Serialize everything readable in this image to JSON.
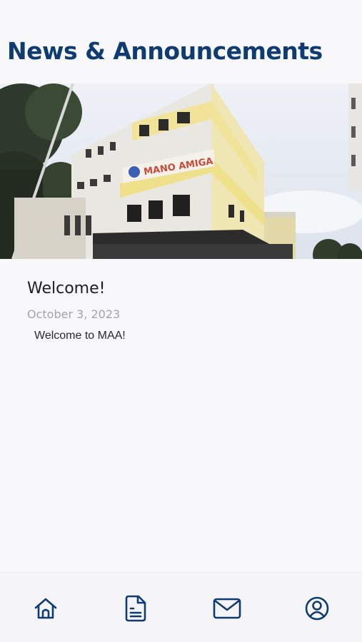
{
  "header": {
    "title": "News & Announcements"
  },
  "hero": {
    "alt": "Building photo",
    "building_sign": "MANO AMIGA"
  },
  "post": {
    "title": "Welcome!",
    "date": "October 3, 2023",
    "body": "Welcome to MAA!"
  },
  "bottom_nav": {
    "items": [
      {
        "icon": "home-icon"
      },
      {
        "icon": "document-icon"
      },
      {
        "icon": "mail-icon"
      },
      {
        "icon": "profile-icon"
      }
    ]
  },
  "colors": {
    "accent": "#0f3b73",
    "background": "#f8f8fa",
    "date_text": "#a4a4a6"
  }
}
